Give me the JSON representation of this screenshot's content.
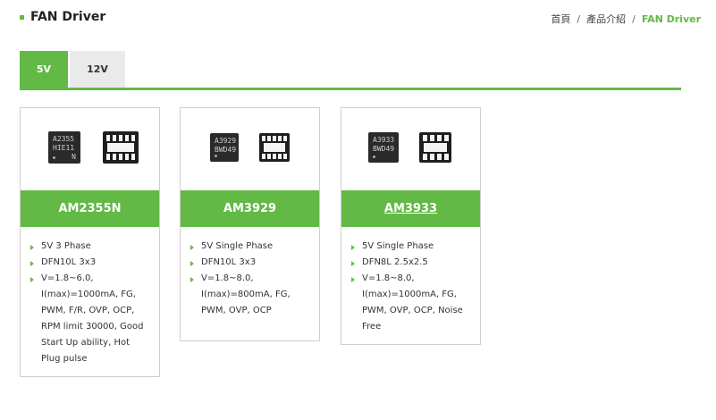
{
  "header": {
    "title": "FAN Driver",
    "breadcrumb": [
      "首頁",
      "產品介紹",
      "FAN Driver"
    ]
  },
  "tabs": [
    {
      "label": "5V",
      "active": true
    },
    {
      "label": "12V",
      "active": false
    }
  ],
  "colors": {
    "accent": "#62b946"
  },
  "products": [
    {
      "name": "AM2355N",
      "chip_marking": [
        "A2355",
        "HIE11",
        "N"
      ],
      "specs": [
        "5V 3 Phase",
        "DFN10L 3x3",
        "V=1.8~6.0, I(max)=1000mA, FG, PWM, F/R, OVP, OCP, RPM limit 30000, Good Start Up ability, Hot Plug pulse"
      ]
    },
    {
      "name": "AM3929",
      "chip_marking": [
        "A3929",
        "BWD49"
      ],
      "specs": [
        "5V Single Phase",
        "DFN10L 3x3",
        "V=1.8~8.0, I(max)=800mA, FG, PWM, OVP, OCP"
      ]
    },
    {
      "name": "AM3933",
      "chip_marking": [
        "A3933",
        "BWD49"
      ],
      "specs": [
        "5V Single Phase",
        "DFN8L 2.5x2.5",
        "V=1.8~8.0, I(max)=1000mA, FG, PWM, OVP, OCP, Noise Free"
      ]
    }
  ]
}
